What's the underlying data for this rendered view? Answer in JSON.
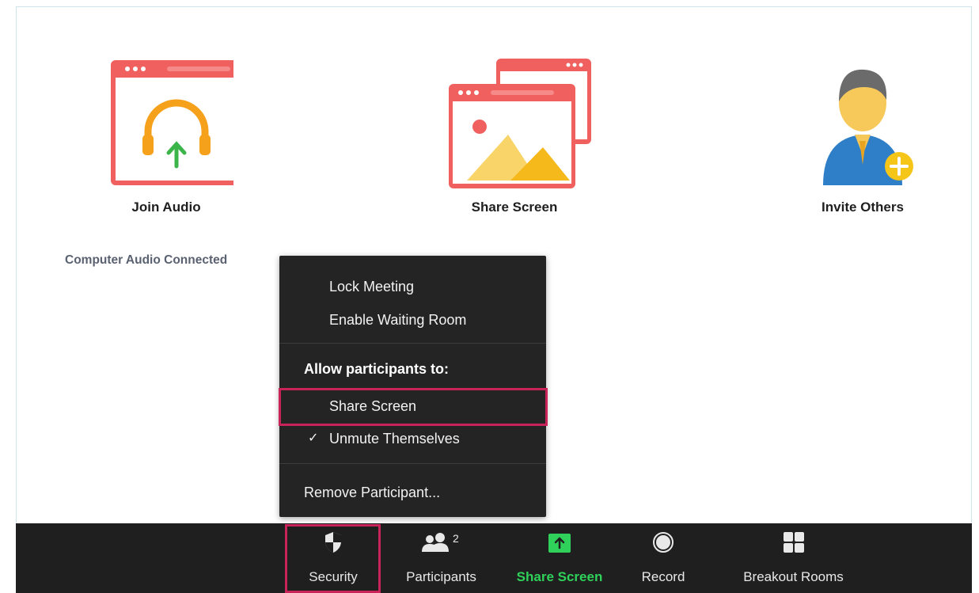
{
  "actions": {
    "join_audio": "Join Audio",
    "share_screen": "Share Screen",
    "invite_others": "Invite Others",
    "audio_status": "Computer Audio Connected"
  },
  "security_menu": {
    "lock_meeting": "Lock Meeting",
    "enable_waiting_room": "Enable Waiting Room",
    "allow_heading": "Allow participants to:",
    "share_screen": "Share Screen",
    "unmute_themselves": "Unmute Themselves",
    "unmute_checked": true,
    "remove_participant": "Remove Participant..."
  },
  "toolbar": {
    "security": "Security",
    "participants": "Participants",
    "participants_count": "2",
    "share_screen": "Share Screen",
    "record": "Record",
    "breakout_rooms": "Breakout Rooms"
  },
  "icons": {
    "join_audio": "headphones-window-icon",
    "share_screen": "image-windows-icon",
    "invite_others": "person-add-icon",
    "security": "shield-icon",
    "participants": "people-icon",
    "share": "share-arrow-icon",
    "record": "record-icon",
    "breakout": "grid-icon"
  },
  "colors": {
    "accent_red": "#f0605f",
    "highlight": "#c8245a",
    "share_green": "#2fd15a",
    "toolbar_bg": "#1f1f1f",
    "menu_bg": "#242424"
  }
}
